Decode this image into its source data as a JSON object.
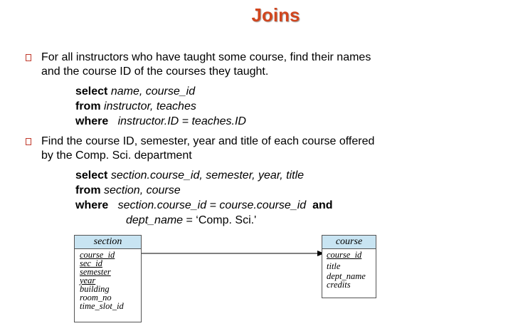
{
  "title": "Joins",
  "bullet1": {
    "line1": "For all instructors who have taught some course, find their names",
    "line2": "and the course ID of the courses they taught."
  },
  "query1": {
    "select_kw": "select",
    "select_args": " name, course_id",
    "from_kw": "from",
    "from_args": " instructor, teaches",
    "where_kw": "where",
    "where_args": "   instructor.ID = teaches.ID"
  },
  "bullet2": {
    "line1": "Find the course ID, semester, year and title of each course offered",
    "line2": "by the Comp. Sci. department"
  },
  "query2": {
    "select_kw": "select",
    "select_args": " section.course_id, semester, year, title",
    "from_kw": "from",
    "from_args": " section, course",
    "where_kw": "where",
    "where_args": "   section.course_id = course.course_id ",
    "and_kw": " and",
    "cond2": "dept_name",
    "cond2_rest": " = ‘Comp. Sci.'"
  },
  "diagram": {
    "section": {
      "name": "section",
      "attrs": [
        "course_id",
        "sec_id",
        "semester",
        "year",
        "building",
        "room_no",
        "time_slot_id"
      ]
    },
    "course": {
      "name": "course",
      "attrs": [
        "course_id",
        "title",
        "dept_name",
        "credits"
      ]
    }
  },
  "colors": {
    "title": "#d1461e",
    "bullet": "#c0392b",
    "table_header": "#c8e4f2"
  }
}
